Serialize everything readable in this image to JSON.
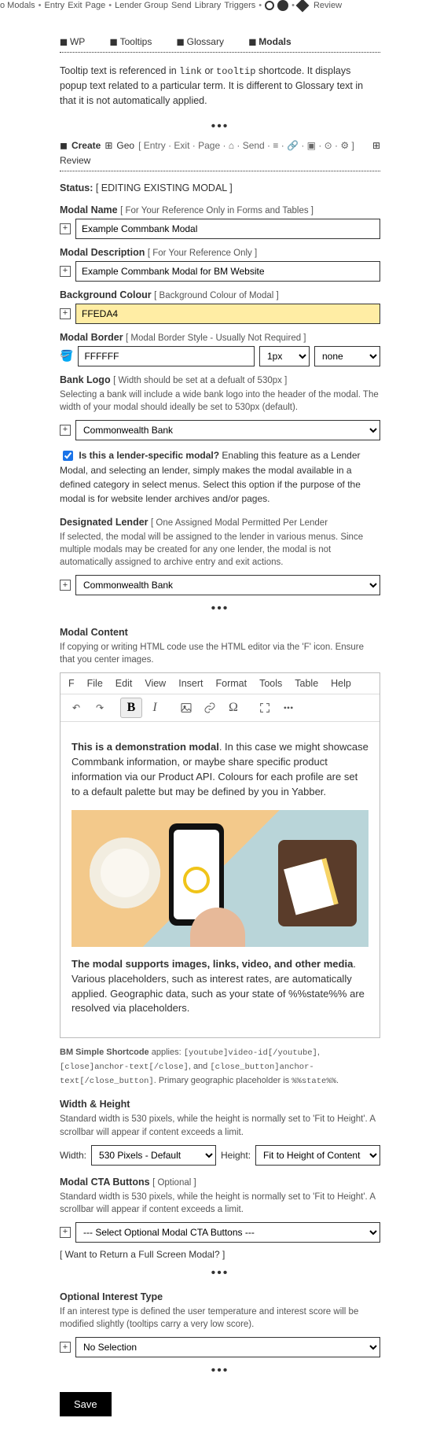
{
  "topnav": {
    "items": [
      "o Modals",
      "Entry",
      "Exit",
      "Page",
      "Lender Group",
      "Send",
      "Library",
      "Triggers"
    ],
    "review": "Review"
  },
  "tabs": {
    "wp": "WP",
    "tooltips": "Tooltips",
    "glossary": "Glossary",
    "modals": "Modals"
  },
  "intro": {
    "t1": "Tooltip text is referenced in ",
    "c1": "link",
    "t2": " or ",
    "c2": "tooltip",
    "t3": " shortcode. It displays popup text related to a particular term. It is different to Glossary text in that it is not automatically applied."
  },
  "createrow": {
    "create": "Create",
    "geo": "Geo",
    "bracket": "[  Entry · Exit · Page · ⌂ · Send · ≡ · 🔗 · ▣ · ⊙ · ⚙  ]",
    "review": "Review"
  },
  "status": {
    "label": "Status:",
    "value": "[ EDITING EXISTING MODAL ]"
  },
  "modalName": {
    "label": "Modal Name",
    "hint": "[ For Your Reference Only in Forms and Tables ]",
    "value": "Example Commbank Modal"
  },
  "modalDesc": {
    "label": "Modal Description",
    "hint": "[ For Your Reference Only ]",
    "value": "Example Commbank Modal for BM Website"
  },
  "bgColour": {
    "label": "Background Colour",
    "hint": "[ Background Colour of Modal ]",
    "value": "FFEDA4"
  },
  "border": {
    "label": "Modal Border",
    "hint": "[ Modal Border Style - Usually Not Required ]",
    "value": "FFFFFF",
    "px": "1px",
    "style": "none"
  },
  "bankLogo": {
    "label": "Bank Logo",
    "hint": "[ Width should be set at a defualt of 530px ]",
    "help": "Selecting a bank will include a wide bank logo into the header of the modal. The width of your modal should ideally be set to 530px (default).",
    "value": "Commonwealth Bank"
  },
  "lenderCheck": {
    "bold": "Is this a lender-specific modal?",
    "rest": " Enabling this feature as a Lender Modal, and selecting an lender, simply makes the modal available in a defined category in select menus. Select this option if the purpose of the modal is for website lender archives and/or pages."
  },
  "designated": {
    "label": "Designated Lender",
    "hint": "[ One Assigned Modal Permitted Per Lender",
    "help": "If selected, the modal will be assigned to the lender in various menus. Since multiple modals may be created for any one lender, the modal is not automatically assigned to archive entry and exit actions.",
    "value": "Commonwealth Bank"
  },
  "modalContent": {
    "label": "Modal Content",
    "help": "If copying or writing HTML code use the HTML editor via the 'F' icon. Ensure that you center images."
  },
  "editorMenu": {
    "f": "F",
    "file": "File",
    "edit": "Edit",
    "view": "View",
    "insert": "Insert",
    "format": "Format",
    "tools": "Tools",
    "table": "Table",
    "help": "Help"
  },
  "editorBody": {
    "p1b": "This is a demonstration modal",
    "p1": ". In this case we might showcase Commbank information, or maybe share specific product information via our Product API. Colours for each profile are set to a default palette but may be defined by you in Yabber.",
    "p2b": "The modal supports images, links, video, and other media",
    "p2": ". Various placeholders, such as interest rates, are automatically applied. Geographic data, such as your state of %%state%% are resolved via placeholders."
  },
  "shortcode": {
    "pre": "BM Simple Shortcode",
    "t1": " applies: ",
    "c1": "[youtube]video-id[/youtube]",
    "c2": "[close]anchor-text[/close]",
    "t2": ", and ",
    "c3": "[close_button]anchor-text[/close_button]",
    "t3": ". Primary geographic placeholder is ",
    "c4": "%%state%%",
    "t4": "."
  },
  "wh": {
    "label": "Width & Height",
    "help": "Standard width is 530 pixels, while the height is normally set to 'Fit to Height'. A scrollbar will appear if content exceeds a limit.",
    "widthLabel": "Width:",
    "widthValue": "530 Pixels - Default",
    "heightLabel": "Height:",
    "heightValue": "Fit to Height of Content"
  },
  "cta": {
    "label": "Modal CTA Buttons",
    "hint": "[ Optional ]",
    "help": "Standard width is 530 pixels, while the height is normally set to 'Fit to Height'. A scrollbar will appear if content exceeds a limit.",
    "value": "--- Select Optional Modal CTA Buttons ---",
    "fullscreen": "[ Want to Return a Full Screen Modal? ]"
  },
  "interest": {
    "label": "Optional Interest Type",
    "help": "If an interest type is defined the user temperature and interest score will be modified slightly (tooltips carry a very low score).",
    "value": "No Selection"
  },
  "save": "Save"
}
